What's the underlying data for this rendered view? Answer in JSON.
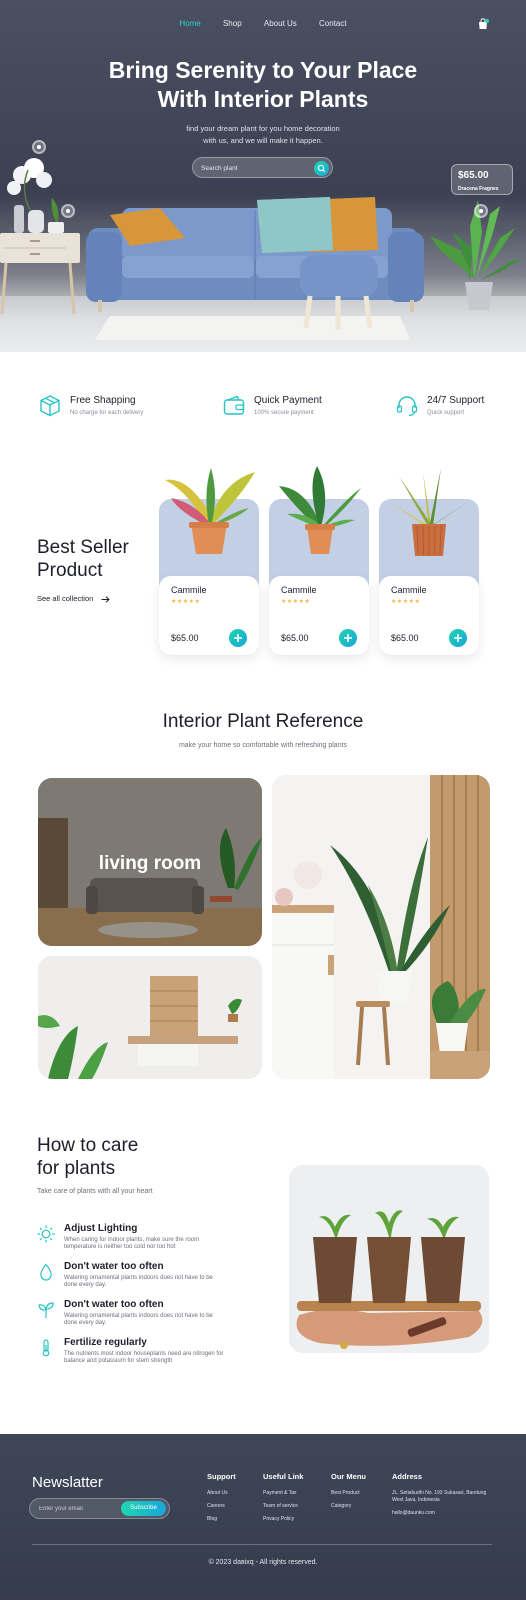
{
  "nav": {
    "items": [
      "Home",
      "Shop",
      "About Us",
      "Contact"
    ],
    "active": "Home",
    "cart_icon": "shopping-bag-icon"
  },
  "hero": {
    "title_line1": "Bring Serenity to Your Place",
    "title_line2": "With Interior Plants",
    "subtitle_line1": "find your dream plant for you home decoration",
    "subtitle_line2": "with us, and we will make it happen.",
    "search_placeholder": "Search plant",
    "search_icon": "search-icon",
    "price_tag": {
      "price": "$65.00",
      "name": "Dracena Fragnes"
    }
  },
  "features": [
    {
      "icon": "box-icon",
      "title": "Free Shapping",
      "subtitle": "No charge for each delivery"
    },
    {
      "icon": "wallet-icon",
      "title": "Quick Payment",
      "subtitle": "100% secure payment"
    },
    {
      "icon": "headset-icon",
      "title": "24/7 Support",
      "subtitle": "Quick support"
    }
  ],
  "best_seller": {
    "title_line1": "Best Seller",
    "title_line2": "Product",
    "link": "See all collection",
    "products": [
      {
        "name": "Cammile",
        "rating": "★★★★★",
        "price": "$65.00"
      },
      {
        "name": "Cammile",
        "rating": "★★★★★",
        "price": "$65.00"
      },
      {
        "name": "Cammile",
        "rating": "★★★★★",
        "price": "$65.00"
      }
    ]
  },
  "reference": {
    "title": "Interior Plant Reference",
    "subtitle": "make your home so comfortable with refreshing plants",
    "label": "living room"
  },
  "care": {
    "title_line1": "How to care",
    "title_line2": "for plants",
    "subtitle": "Take care of plants with all your heart",
    "items": [
      {
        "icon": "sun-icon",
        "title": "Adjust Lighting",
        "desc": "When caring for indoor plants, make sure the room temperature is neither too cold nor too hot"
      },
      {
        "icon": "water-drop-icon",
        "title": "Don't water too often",
        "desc": "Watering ornamental plants indoors does not have to be done every day."
      },
      {
        "icon": "sprout-icon",
        "title": "Don't water too often",
        "desc": "Watering ornamental plants indoors does not have to be done every day."
      },
      {
        "icon": "thermometer-icon",
        "title": "Fertilize regularly",
        "desc": "The nutrients most indoor houseplants need are nitrogen for balance and potassium for stem strength"
      }
    ]
  },
  "footer": {
    "newsletter_title": "Newslatter",
    "email_placeholder": "Enter your email",
    "subscribe": "Subscribe",
    "columns": [
      {
        "heading": "Support",
        "items": [
          "About Us",
          "Careers",
          "Blog"
        ]
      },
      {
        "heading": "Useful Link",
        "items": [
          "Payment & Tax",
          "Team of service",
          "Privacy Policy"
        ]
      },
      {
        "heading": "Our Menu",
        "items": [
          "Best Product",
          "Category"
        ]
      }
    ],
    "address": {
      "heading": "Address",
      "line": "JL. Setiabudhi No. 193 Sukasari, Bandung West Java, Indonesia",
      "email": "hallo@daunku.com"
    },
    "copyright": "© 2023 dавixq - All rights reserved."
  },
  "colors": {
    "accent": "#2ed3c0",
    "hero_bg": "#3b4052",
    "card_bg": "#c3cfe4",
    "star": "#f0b941",
    "footer_bg": "#3a4052"
  }
}
